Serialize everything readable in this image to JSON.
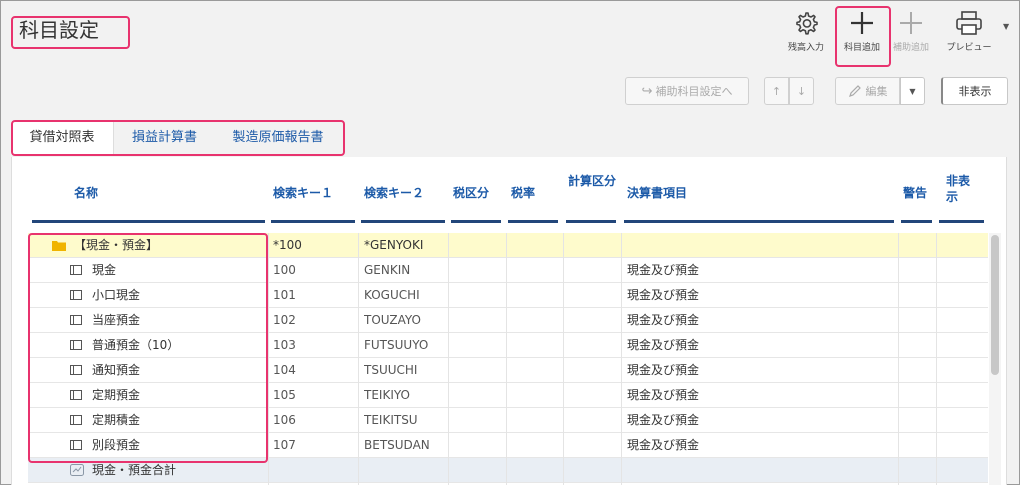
{
  "page": {
    "title": "科目設定"
  },
  "toolbar": {
    "balance_label": "残高入力",
    "add_account_label": "科目追加",
    "add_sub_label": "補助追加",
    "preview_label": "プレビュー"
  },
  "secondary": {
    "sub_settings_label": "補助科目設定へ",
    "up_label": "↑",
    "down_label": "↓",
    "edit_label": "編集",
    "hide_label": "非表示"
  },
  "tabs": [
    {
      "label": "貸借対照表",
      "active": true
    },
    {
      "label": "損益計算書",
      "active": false
    },
    {
      "label": "製造原価報告書",
      "active": false
    }
  ],
  "columns": {
    "name": "名称",
    "key1": "検索キー１",
    "key2": "検索キー２",
    "tax_class": "税区分",
    "tax_rate": "税率",
    "calc_class": "計算区分",
    "statement_item": "決算書項目",
    "warning": "警告",
    "hidden": "非表示"
  },
  "rows": [
    {
      "type": "folder",
      "name": "【現金・預金】",
      "key1": "*100",
      "key2": "*GENYOKI",
      "statement": ""
    },
    {
      "type": "account",
      "name": "現金",
      "key1": "100",
      "key2": "GENKIN",
      "statement": "現金及び預金"
    },
    {
      "type": "account",
      "name": "小口現金",
      "key1": "101",
      "key2": "KOGUCHI",
      "statement": "現金及び預金"
    },
    {
      "type": "account",
      "name": "当座預金",
      "key1": "102",
      "key2": "TOUZAYO",
      "statement": "現金及び預金"
    },
    {
      "type": "account",
      "name": "普通預金（10）",
      "key1": "103",
      "key2": "FUTSUUYO",
      "statement": "現金及び預金"
    },
    {
      "type": "account",
      "name": "通知預金",
      "key1": "104",
      "key2": "TSUUCHI",
      "statement": "現金及び預金"
    },
    {
      "type": "account",
      "name": "定期預金",
      "key1": "105",
      "key2": "TEIKIYO",
      "statement": "現金及び預金"
    },
    {
      "type": "account",
      "name": "定期積金",
      "key1": "106",
      "key2": "TEIKITSU",
      "statement": "現金及び預金"
    },
    {
      "type": "account",
      "name": "別段預金",
      "key1": "107",
      "key2": "BETSUDAN",
      "statement": "現金及び預金"
    },
    {
      "type": "total",
      "name": "現金・預金合計",
      "key1": "",
      "key2": "",
      "statement": ""
    }
  ],
  "colors": {
    "header_text": "#1c5aa8",
    "highlight_border": "#e8336e",
    "folder_row": "#fefbcc",
    "folder_icon": "#f0b400",
    "header_underline": "#22467a"
  }
}
